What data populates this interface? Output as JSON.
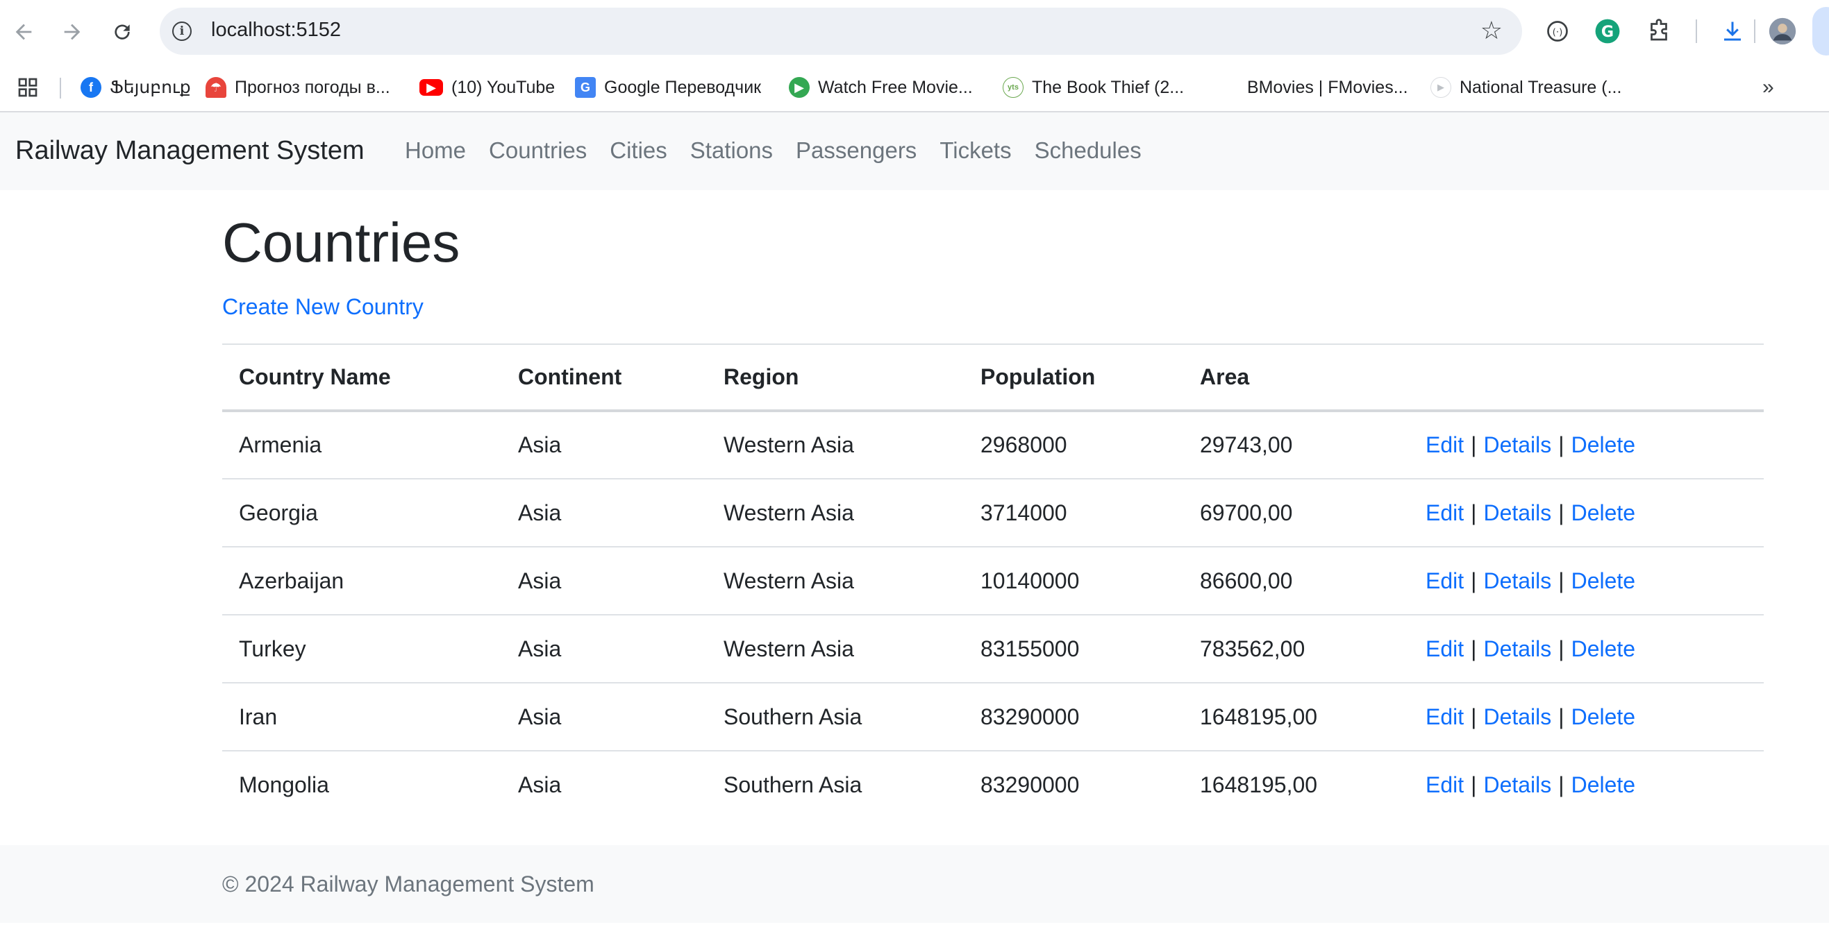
{
  "browser": {
    "url": "localhost:5152",
    "bookmarks": [
      {
        "label": "Ֆեյսբուք",
        "icon": "facebook-icon",
        "color": "#1877f2"
      },
      {
        "label": "Прогноз погоды в...",
        "icon": "umbrella-icon",
        "color": "#e8453c"
      },
      {
        "label": "(10) YouTube",
        "icon": "youtube-icon",
        "color": "#ff0000"
      },
      {
        "label": "Google Переводчик",
        "icon": "translate-icon",
        "color": "#4285f4"
      },
      {
        "label": "Watch Free Movie...",
        "icon": "play-icon",
        "color": "#34a853"
      },
      {
        "label": "The Book Thief (2...",
        "icon": "yts-icon",
        "color": "#6aa84f"
      },
      {
        "label": "BMovies | FMovies...",
        "icon": "",
        "color": ""
      },
      {
        "label": "National Treasure (...",
        "icon": "play-icon",
        "color": "#dadce0"
      }
    ]
  },
  "navbar": {
    "brand": "Railway Management System",
    "links": [
      "Home",
      "Countries",
      "Cities",
      "Stations",
      "Passengers",
      "Tickets",
      "Schedules"
    ]
  },
  "page": {
    "title": "Countries",
    "create_link": "Create New Country"
  },
  "table": {
    "headers": [
      "Country Name",
      "Continent",
      "Region",
      "Population",
      "Area"
    ],
    "actions": {
      "edit": "Edit",
      "details": "Details",
      "delete": "Delete",
      "separator": "|"
    },
    "rows": [
      [
        "Armenia",
        "Asia",
        "Western Asia",
        "2968000",
        "29743,00"
      ],
      [
        "Georgia",
        "Asia",
        "Western Asia",
        "3714000",
        "69700,00"
      ],
      [
        "Azerbaijan",
        "Asia",
        "Western Asia",
        "10140000",
        "86600,00"
      ],
      [
        "Turkey",
        "Asia",
        "Western Asia",
        "83155000",
        "783562,00"
      ],
      [
        "Iran",
        "Asia",
        "Southern Asia",
        "83290000",
        "1648195,00"
      ],
      [
        "Mongolia",
        "Asia",
        "Southern Asia",
        "83290000",
        "1648195,00"
      ]
    ]
  },
  "footer": {
    "text": "© 2024 Railway Management System"
  },
  "colors": {
    "link": "#0d6efd",
    "navbar_bg": "#f8f9fa",
    "muted": "#6c757d"
  }
}
